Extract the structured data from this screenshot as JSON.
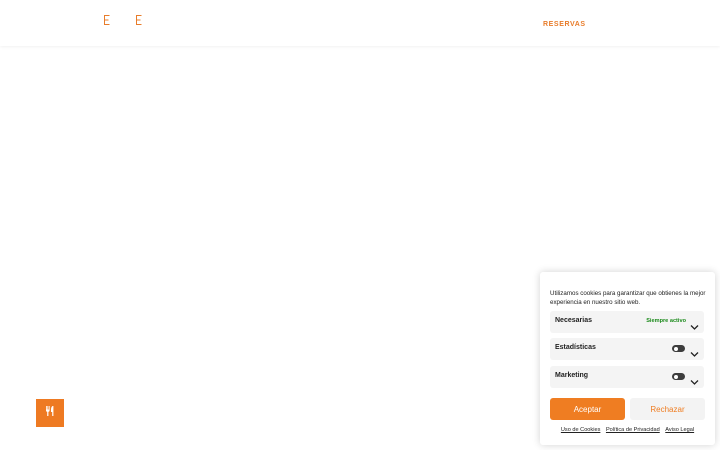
{
  "header": {
    "logo_icons": [
      "logo-glyph-left",
      "logo-glyph-right"
    ],
    "reservas_label": "RESERVAS"
  },
  "fab": {
    "icon": "utensils-icon"
  },
  "cookie_banner": {
    "message": "Utilizamos cookies para garantizar que obtienes la mejor experiencia en nuestro sitio web.",
    "categories": [
      {
        "label": "Necesarias",
        "status": "Siempre activo"
      },
      {
        "label": "Estadísticas",
        "status": ""
      },
      {
        "label": "Marketing",
        "status": ""
      }
    ],
    "accept_label": "Aceptar",
    "reject_label": "Rechazar",
    "links": [
      "Uso de Cookies",
      "Política de Privacidad",
      "Aviso Legal"
    ]
  },
  "colors": {
    "accent": "#ef7d22",
    "active_green": "#1a8a1a",
    "toggle_off": "#3d3d3d",
    "row_bg": "#f4f4f4"
  }
}
